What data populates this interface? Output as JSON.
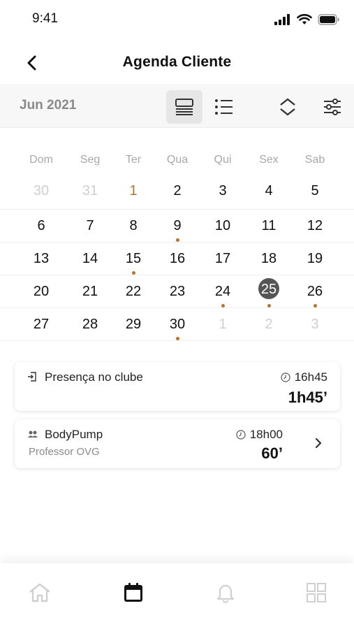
{
  "status_bar": {
    "time": "9:41"
  },
  "header": {
    "title": "Agenda Cliente"
  },
  "toolbar": {
    "month": "Jun 2021"
  },
  "calendar": {
    "weekdays": [
      "Dom",
      "Seg",
      "Ter",
      "Qua",
      "Qui",
      "Sex",
      "Sab"
    ],
    "weeks": [
      [
        {
          "n": "30",
          "muted": true
        },
        {
          "n": "31",
          "muted": true
        },
        {
          "n": "1",
          "accent": true
        },
        {
          "n": "2"
        },
        {
          "n": "3"
        },
        {
          "n": "4"
        },
        {
          "n": "5"
        }
      ],
      [
        {
          "n": "6"
        },
        {
          "n": "7"
        },
        {
          "n": "8"
        },
        {
          "n": "9",
          "dot": true
        },
        {
          "n": "10"
        },
        {
          "n": "11"
        },
        {
          "n": "12"
        }
      ],
      [
        {
          "n": "13"
        },
        {
          "n": "14"
        },
        {
          "n": "15",
          "dot": true
        },
        {
          "n": "16"
        },
        {
          "n": "17"
        },
        {
          "n": "18"
        },
        {
          "n": "19"
        }
      ],
      [
        {
          "n": "20"
        },
        {
          "n": "21"
        },
        {
          "n": "22"
        },
        {
          "n": "23"
        },
        {
          "n": "24",
          "dot": true
        },
        {
          "n": "25",
          "selected": true,
          "dot": true
        },
        {
          "n": "26",
          "dot": true
        }
      ],
      [
        {
          "n": "27"
        },
        {
          "n": "28"
        },
        {
          "n": "29"
        },
        {
          "n": "30",
          "dot": true
        },
        {
          "n": "1",
          "muted": true
        },
        {
          "n": "2",
          "muted": true
        },
        {
          "n": "3",
          "muted": true
        }
      ]
    ]
  },
  "events": {
    "presence": {
      "title": "Presença no clube",
      "time": "16h45",
      "duration": "1h45’"
    },
    "class": {
      "title": "BodyPump",
      "subtitle": "Professor OVG",
      "time": "18h00",
      "duration": "60’"
    }
  },
  "colors": {
    "accent": "#b5742a",
    "selected": "#555555",
    "muted": "#cfcfcf"
  },
  "tab_bar": {
    "tabs": [
      "home-icon",
      "calendar-icon",
      "bell-icon",
      "grid-icon"
    ],
    "active": "calendar-icon"
  }
}
